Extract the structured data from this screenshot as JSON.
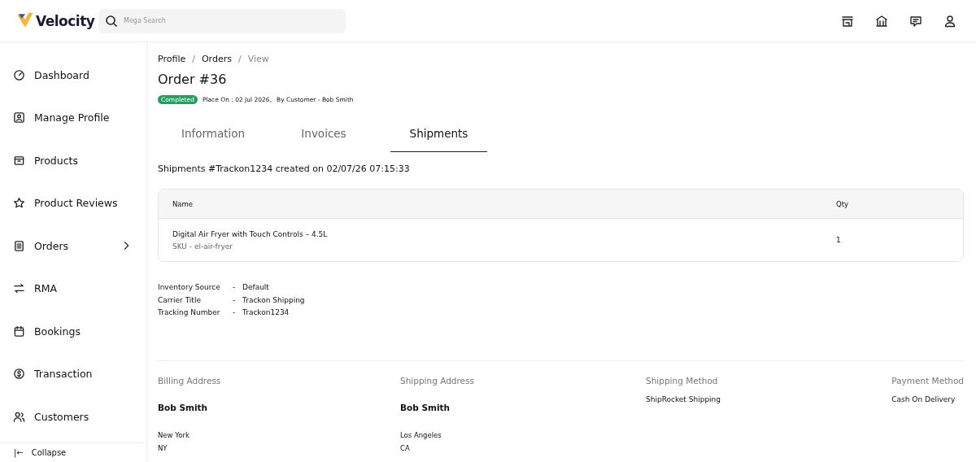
{
  "brand": {
    "name": "Velocity"
  },
  "search": {
    "placeholder": "Mega Search"
  },
  "sidebar": {
    "items": [
      {
        "label": "Dashboard",
        "has_submenu": false
      },
      {
        "label": "Manage Profile",
        "has_submenu": false
      },
      {
        "label": "Products",
        "has_submenu": false
      },
      {
        "label": "Product Reviews",
        "has_submenu": false
      },
      {
        "label": "Orders",
        "has_submenu": true
      },
      {
        "label": "RMA",
        "has_submenu": false
      },
      {
        "label": "Bookings",
        "has_submenu": false
      },
      {
        "label": "Transaction",
        "has_submenu": false
      },
      {
        "label": "Customers",
        "has_submenu": false
      }
    ],
    "collapse": {
      "arrow": "|←",
      "label": "Collapse"
    }
  },
  "breadcrumb": [
    {
      "label": "Profile",
      "current": false
    },
    {
      "label": "Orders",
      "current": false
    },
    {
      "label": "View",
      "current": true
    }
  ],
  "breadcrumb_separator": "/",
  "order": {
    "title": "Order #36",
    "status": "Completed",
    "placed_on": "Place On : 02 Jul 2026,",
    "customer": "By Customer - Bob Smith"
  },
  "tabs": [
    {
      "label": "Information",
      "selected": false
    },
    {
      "label": "Invoices",
      "selected": false
    },
    {
      "label": "Shipments",
      "selected": true
    }
  ],
  "shipment": {
    "heading": "Shipments #Trackon1234  created on 02/07/26 07:15:33",
    "table": {
      "columns": [
        "Name",
        "Qty"
      ],
      "rows": [
        {
          "name": "Digital Air Fryer with Touch Controls – 4.5L",
          "sku": "SKU - el-air-fryer",
          "qty": "1"
        }
      ]
    },
    "details": [
      {
        "label": "Inventory Source",
        "value": "Default"
      },
      {
        "label": "Carrier Title",
        "value": "Trackon Shipping"
      },
      {
        "label": "Tracking Number",
        "value": "Trackon1234"
      }
    ],
    "detail_separator": "-"
  },
  "summary": [
    {
      "kind": "address",
      "heading": "Billing Address",
      "name": "Bob Smith",
      "lines": [
        "New York",
        "NY"
      ]
    },
    {
      "kind": "address",
      "heading": "Shipping Address",
      "name": "Bob Smith",
      "lines": [
        "Los Angeles",
        "CA"
      ]
    },
    {
      "kind": "method",
      "heading": "Shipping Method",
      "value": "ShipRocket Shipping"
    },
    {
      "kind": "method",
      "heading": "Payment Method",
      "value": "Cash On Delivery"
    }
  ]
}
